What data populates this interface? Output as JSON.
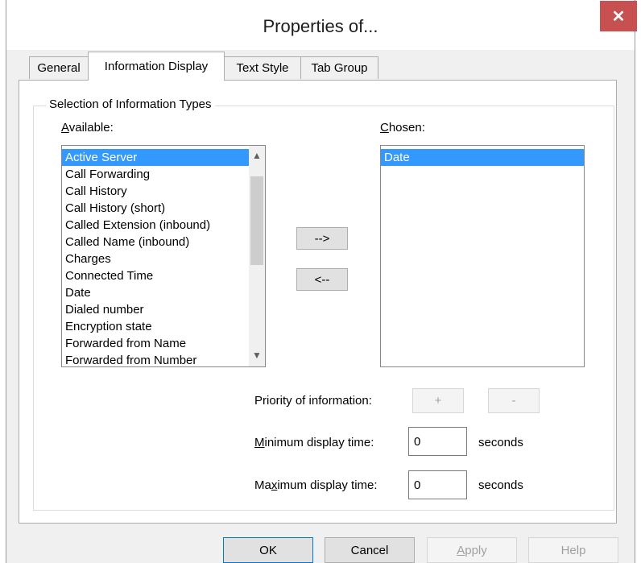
{
  "window": {
    "title": "Properties of...",
    "close_glyph": "✕"
  },
  "tabs": [
    {
      "label": "General"
    },
    {
      "label": "Information Display"
    },
    {
      "label": "Text Style"
    },
    {
      "label": "Tab Group"
    }
  ],
  "group": {
    "legend": "Selection of Information Types",
    "available": {
      "label_first": "A",
      "label_rest": "vailable:",
      "items": [
        "Active Server",
        "Call Forwarding",
        "Call History",
        "Call History (short)",
        "Called Extension (inbound)",
        "Called Name (inbound)",
        "Charges",
        "Connected Time",
        "Date",
        "Dialed number",
        "Encryption state",
        "Forwarded from Name",
        "Forwarded from Number"
      ],
      "selected_index": 0
    },
    "chosen": {
      "label_first": "C",
      "label_rest": "hosen:",
      "items": [
        "Date"
      ],
      "selected_index": 0
    },
    "add_label": "-->",
    "remove_label": "<--",
    "priority_label": "Priority of information:",
    "priority_up_label": "+",
    "priority_down_label": "-",
    "min_label_first": "M",
    "min_label_rest": "inimum display time:",
    "min_value": "0",
    "max_label_a": "Ma",
    "max_label_u": "x",
    "max_label_b": "imum display time:",
    "max_value": "0",
    "seconds_label": "seconds"
  },
  "footer": {
    "ok_label": "OK",
    "cancel_label": "Cancel",
    "apply_label_first": "A",
    "apply_label_rest": "pply",
    "help_label": "Help"
  },
  "colors": {
    "selection": "#3399ff",
    "close_button": "#c75050"
  }
}
